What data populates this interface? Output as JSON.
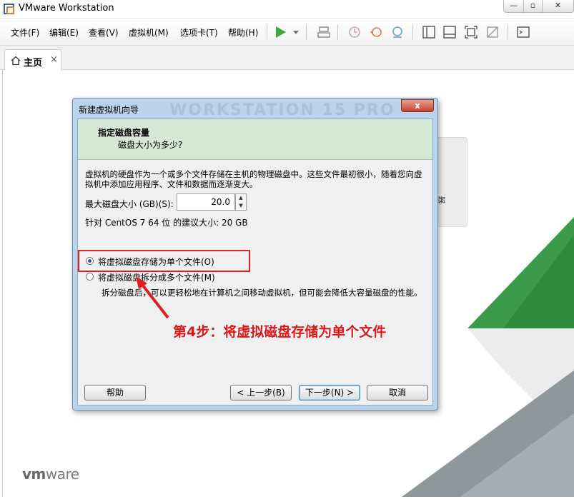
{
  "window": {
    "title": "VMware Workstation",
    "min": "—",
    "max": "▫",
    "close": "✕"
  },
  "menu": [
    "文件(F)",
    "编辑(E)",
    "查看(V)",
    "虚拟机(M)",
    "选项卡(T)",
    "帮助(H)"
  ],
  "tabs": [
    {
      "label": "主页",
      "close": "×"
    }
  ],
  "side_panel": {
    "char": "器"
  },
  "logo": {
    "text_bold": "vm",
    "text_rest": "ware"
  },
  "dialog": {
    "title": "新建虚拟机向导",
    "watermark": "WORKSTATION 15 PRO",
    "close": "x",
    "header_title": "指定磁盘容量",
    "header_subtitle": "磁盘大小为多少?",
    "description": "虚拟机的硬盘作为一个或多个文件存储在主机的物理磁盘中。这些文件最初很小，随着您向虚拟机中添加应用程序、文件和数据而逐渐变大。",
    "max_size_label": "最大磁盘大小 (GB)(S):",
    "max_size_value": "20.0",
    "recommend": "针对 CentOS 7 64 位 的建议大小: 20 GB",
    "radio_single": "将虚拟磁盘存储为单个文件(O)",
    "radio_split": "将虚拟磁盘拆分成多个文件(M)",
    "split_desc": "拆分磁盘后，可以更轻松地在计算机之间移动虚拟机，但可能会降低大容量磁盘的性能。",
    "btn_help": "帮助",
    "btn_back": "< 上一步(B)",
    "btn_next": "下一步(N) >",
    "btn_cancel": "取消"
  },
  "annotation": {
    "step_text": "第4步：将虚拟磁盘存储为单个文件"
  },
  "colors": {
    "accent_green": "#3caa3c",
    "annotation_red": "#e02020",
    "dialog_header": "#d4e8d4"
  }
}
